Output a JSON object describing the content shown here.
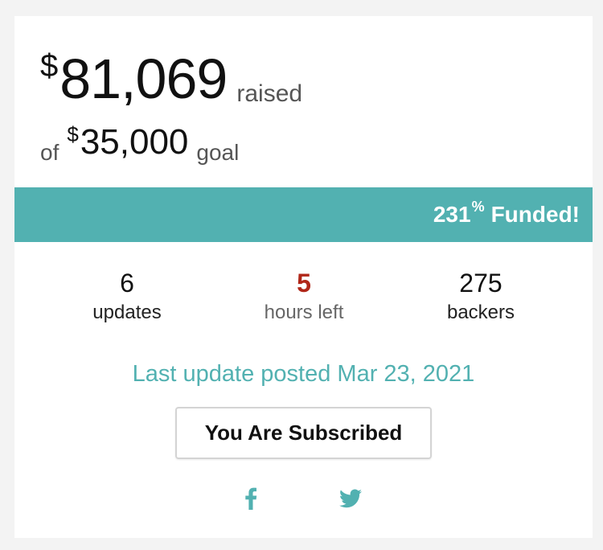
{
  "funding": {
    "currency_symbol": "$",
    "raised_amount": "81,069",
    "raised_label": "raised",
    "goal_prefix": "of",
    "goal_amount": "35,000",
    "goal_label": "goal",
    "percent_funded": "231",
    "percent_symbol": "%",
    "funded_label": "Funded!",
    "progress_fraction": 1.0
  },
  "stats": {
    "updates": {
      "value": "6",
      "label": "updates"
    },
    "hours_left": {
      "value": "5",
      "label": "hours left"
    },
    "backers": {
      "value": "275",
      "label": "backers"
    }
  },
  "last_update_text": "Last update posted Mar 23, 2021",
  "subscribe_button_label": "You Are Subscribed",
  "share": {
    "icons": [
      "facebook-icon",
      "twitter-icon"
    ]
  },
  "colors": {
    "accent": "#52b1b1",
    "alert": "#b02618",
    "background": "#f3f3f3",
    "card": "#ffffff"
  }
}
